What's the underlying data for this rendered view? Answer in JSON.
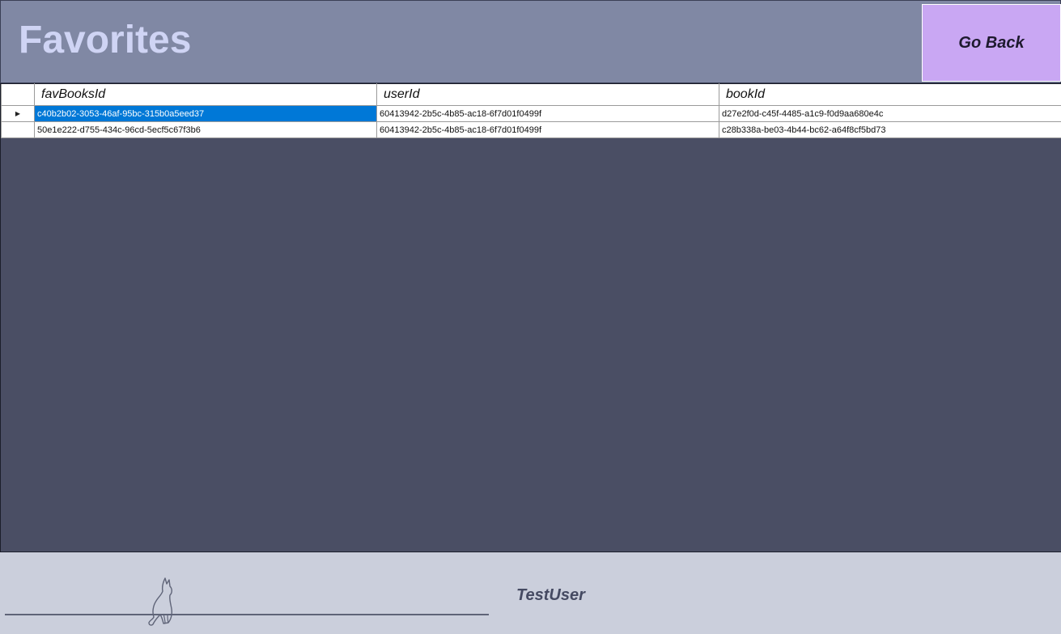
{
  "header": {
    "title": "Favorites",
    "go_back_label": "Go Back"
  },
  "grid": {
    "columns": [
      "favBooksId",
      "userId",
      "bookId"
    ],
    "rows": [
      {
        "current": true,
        "favBooksId": "c40b2b02-3053-46af-95bc-315b0a5eed37",
        "userId": "60413942-2b5c-4b85-ac18-6f7d01f0499f",
        "bookId": "d27e2f0d-c45f-4485-a1c9-f0d9aa680e4c"
      },
      {
        "current": false,
        "favBooksId": "50e1e222-d755-434c-96cd-5ecf5c67f3b6",
        "userId": "60413942-2b5c-4b85-ac18-6f7d01f0499f",
        "bookId": "c28b338a-be03-4b44-bc62-a64f8cf5bd73"
      }
    ],
    "current_row_marker": "▶"
  },
  "footer": {
    "username": "TestUser",
    "icon": "cat-icon"
  },
  "colors": {
    "header_bg": "#8088a4",
    "title": "#cfd4f4",
    "button_bg": "#c9a7f3",
    "grid_bg": "#4a4e64",
    "selection": "#0078d7",
    "footer_bg": "#cbcfdc",
    "username": "#454a62"
  }
}
